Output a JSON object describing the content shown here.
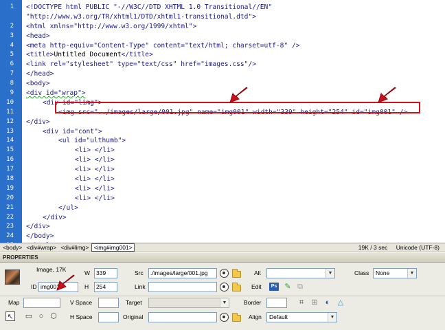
{
  "editor": {
    "lines": [
      {
        "n": "1",
        "indent": 0,
        "parts": [
          {
            "t": "<!DOCTYPE html PUBLIC \"-//W3C//DTD XHTML 1.0 Transitional//EN\"",
            "c": "tag"
          }
        ]
      },
      {
        "n": "",
        "indent": 0,
        "parts": [
          {
            "t": "\"http://www.w3.org/TR/xhtml1/DTD/xhtml1-transitional.dtd\">",
            "c": "tag"
          }
        ]
      },
      {
        "n": "2",
        "indent": 0,
        "parts": [
          {
            "t": "<html xmlns=\"http://www.w3.org/1999/xhtml\">",
            "c": "tag"
          }
        ]
      },
      {
        "n": "3",
        "indent": 0,
        "parts": [
          {
            "t": "<head>",
            "c": "tag"
          }
        ]
      },
      {
        "n": "4",
        "indent": 0,
        "parts": [
          {
            "t": "<meta http-equiv=\"Content-Type\" content=\"text/html; charset=utf-8\" />",
            "c": "tag"
          }
        ]
      },
      {
        "n": "5",
        "indent": 0,
        "parts": [
          {
            "t": "<title>",
            "c": "tag"
          },
          {
            "t": "Untitled Document",
            "c": "txt"
          },
          {
            "t": "</title>",
            "c": "tag"
          }
        ]
      },
      {
        "n": "6",
        "indent": 0,
        "parts": [
          {
            "t": "<link rel=\"stylesheet\" type=\"text/css\" href=\"images.css\"/>",
            "c": "tag"
          }
        ]
      },
      {
        "n": "7",
        "indent": 0,
        "parts": [
          {
            "t": "</head>",
            "c": "tag"
          }
        ]
      },
      {
        "n": "8",
        "indent": 0,
        "parts": [
          {
            "t": "<body>",
            "c": "tag"
          }
        ]
      },
      {
        "n": "9",
        "indent": 0,
        "parts": [
          {
            "t": "<div id=\"wrap\">",
            "c": "tag squig"
          }
        ]
      },
      {
        "n": "10",
        "indent": 1,
        "parts": [
          {
            "t": "<div id=\"limg\">",
            "c": "tag"
          }
        ]
      },
      {
        "n": "11",
        "indent": 2,
        "parts": [
          {
            "t": "<img src=\"../images/large/001.jpg\" name=\"img001\" width=\"339\" height=\"254\" id=\"img001\" />",
            "c": "tag"
          }
        ]
      },
      {
        "n": "12",
        "indent": 0,
        "parts": [
          {
            "t": "</div>",
            "c": "tag"
          }
        ]
      },
      {
        "n": "13",
        "indent": 1,
        "parts": [
          {
            "t": "<div id=\"cont\">",
            "c": "tag"
          }
        ]
      },
      {
        "n": "14",
        "indent": 2,
        "parts": [
          {
            "t": "<ul id=\"ulthumb\">",
            "c": "tag"
          }
        ]
      },
      {
        "n": "15",
        "indent": 3,
        "parts": [
          {
            "t": "<li> </li>",
            "c": "tag"
          }
        ]
      },
      {
        "n": "16",
        "indent": 3,
        "parts": [
          {
            "t": "<li> </li>",
            "c": "tag"
          }
        ]
      },
      {
        "n": "17",
        "indent": 3,
        "parts": [
          {
            "t": "<li> </li>",
            "c": "tag"
          }
        ]
      },
      {
        "n": "18",
        "indent": 3,
        "parts": [
          {
            "t": "<li> </li>",
            "c": "tag"
          }
        ]
      },
      {
        "n": "19",
        "indent": 3,
        "parts": [
          {
            "t": "<li> </li>",
            "c": "tag"
          }
        ]
      },
      {
        "n": "20",
        "indent": 3,
        "parts": [
          {
            "t": "<li> </li>",
            "c": "tag"
          }
        ]
      },
      {
        "n": "21",
        "indent": 2,
        "parts": [
          {
            "t": "</ul>",
            "c": "tag"
          }
        ]
      },
      {
        "n": "22",
        "indent": 1,
        "parts": [
          {
            "t": "</div>",
            "c": "tag"
          }
        ]
      },
      {
        "n": "23",
        "indent": 0,
        "parts": [
          {
            "t": "</div>",
            "c": "tag"
          }
        ]
      },
      {
        "n": "24",
        "indent": 0,
        "parts": [
          {
            "t": "</body>",
            "c": "tag"
          }
        ]
      },
      {
        "n": "25",
        "indent": 0,
        "parts": [
          {
            "t": "</html>",
            "c": "tag"
          }
        ]
      }
    ]
  },
  "tag_selector": {
    "crumbs": [
      "<body>",
      "<div#wrap>",
      "<div#limg>",
      "<img#img001>"
    ],
    "selected_index": 3,
    "size_time": "19K / 3 sec",
    "encoding": "Unicode (UTF-8)"
  },
  "properties": {
    "header": "PROPERTIES",
    "image_info": "Image, 17K",
    "id_label": "ID",
    "id_value": "img001",
    "w_label": "W",
    "w_value": "339",
    "h_label": "H",
    "h_value": "254",
    "src_label": "Src",
    "src_value": "./images/large/001.jpg",
    "link_label": "Link",
    "link_value": "",
    "alt_label": "Alt",
    "alt_value": "",
    "edit_label": "Edit",
    "class_label": "Class",
    "class_value": "None",
    "map_label": "Map",
    "map_value": "",
    "vspace_label": "V Space",
    "vspace_value": "",
    "hspace_label": "H Space",
    "hspace_value": "",
    "target_label": "Target",
    "target_value": "",
    "original_label": "Original",
    "original_value": "",
    "border_label": "Border",
    "border_value": "",
    "align_label": "Align",
    "align_value": "Default",
    "edit_ps_icon": "Ps"
  },
  "colors": {
    "gutter": "#2a6fc9",
    "highlight": "#d0131a",
    "code": "#1a1a8c"
  }
}
